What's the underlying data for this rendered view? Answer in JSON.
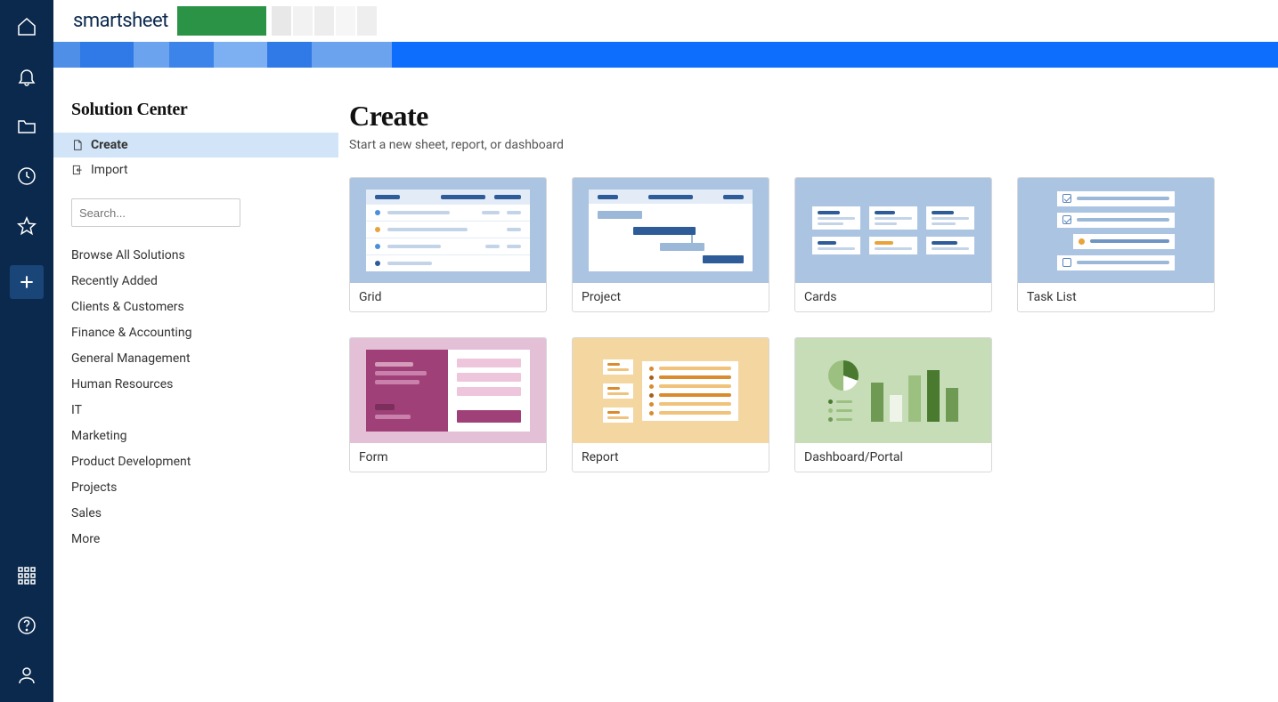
{
  "brand": "smartsheet",
  "sidebar": {
    "title": "Solution Center",
    "nav": [
      {
        "label": "Create",
        "active": true
      },
      {
        "label": "Import",
        "active": false
      }
    ],
    "search_placeholder": "Search...",
    "categories": [
      "Browse All Solutions",
      "Recently Added",
      "Clients & Customers",
      "Finance & Accounting",
      "General Management",
      "Human Resources",
      "IT",
      "Marketing",
      "Product Development",
      "Projects",
      "Sales",
      "More"
    ]
  },
  "create": {
    "title": "Create",
    "subtitle": "Start a new sheet, report, or dashboard",
    "templates": [
      {
        "id": "grid",
        "label": "Grid"
      },
      {
        "id": "project",
        "label": "Project"
      },
      {
        "id": "cards",
        "label": "Cards"
      },
      {
        "id": "tasklist",
        "label": "Task List"
      },
      {
        "id": "form",
        "label": "Form"
      },
      {
        "id": "report",
        "label": "Report"
      },
      {
        "id": "dashboard",
        "label": "Dashboard/Portal"
      }
    ]
  },
  "colors": {
    "rail": "#0b294d",
    "banner": "#0d6efd",
    "active_nav": "#d2e4f7"
  }
}
